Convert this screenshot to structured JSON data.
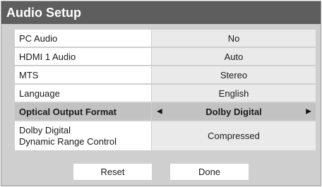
{
  "window": {
    "title": "Audio Setup"
  },
  "settings": [
    {
      "label": "PC Audio",
      "value": "No"
    },
    {
      "label": "HDMI 1 Audio",
      "value": "Auto"
    },
    {
      "label": "MTS",
      "value": "Stereo"
    },
    {
      "label": "Language",
      "value": "English"
    },
    {
      "label": "Optical Output Format",
      "value": "Dolby Digital",
      "selected": true,
      "left_arrow": "◀",
      "right_arrow": "▶"
    },
    {
      "label_line1": "Dolby Digital",
      "label_line2": "Dynamic Range Control",
      "value": "Compressed"
    }
  ],
  "buttons": {
    "reset_label": "Reset",
    "done_label": "Done"
  },
  "colors": {
    "title_bar": "#5e5e5e",
    "panel_bg": "#cfcfcf",
    "label_bg": "#ffffff",
    "value_bg": "#eaeaea",
    "selected_bg": "#c2c2c2"
  }
}
